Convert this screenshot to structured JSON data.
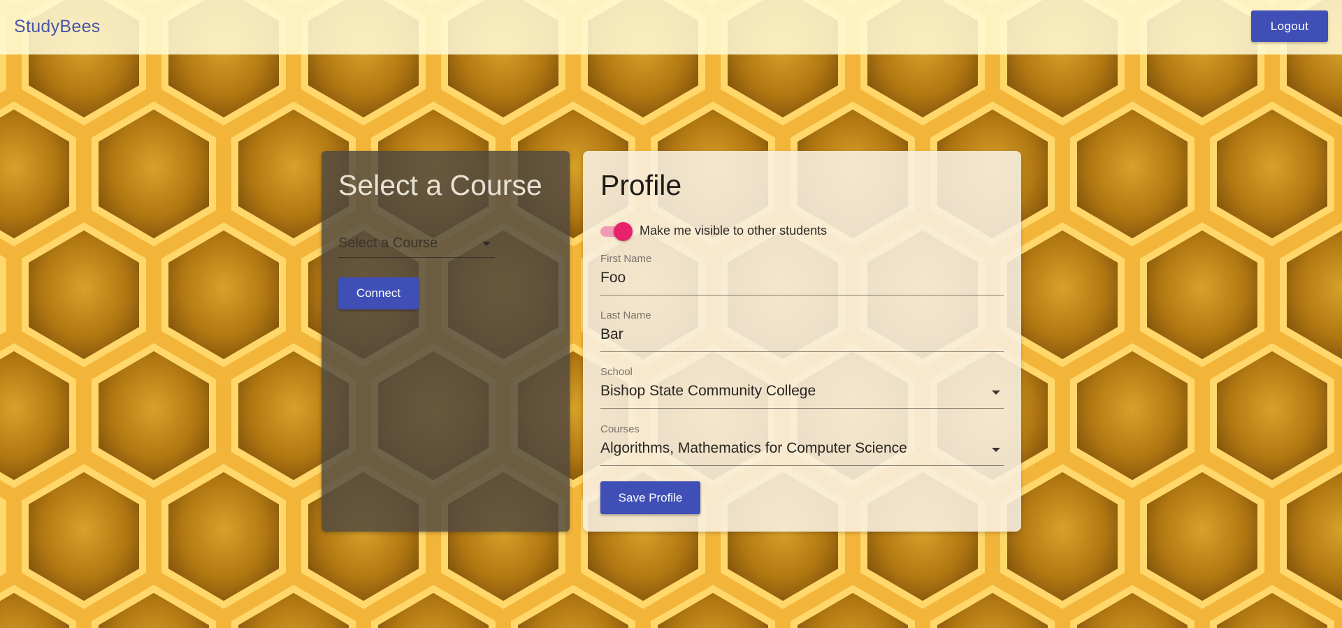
{
  "app": {
    "title": "StudyBees",
    "logout_label": "Logout"
  },
  "course_panel": {
    "title": "Select a Course",
    "select_placeholder": "Select a Course",
    "connect_label": "Connect"
  },
  "profile": {
    "title": "Profile",
    "visibility_toggle": {
      "label": "Make me visible to other students",
      "on": true
    },
    "fields": {
      "first_name": {
        "label": "First Name",
        "value": "Foo"
      },
      "last_name": {
        "label": "Last Name",
        "value": "Bar"
      },
      "school": {
        "label": "School",
        "value": "Bishop State Community College"
      },
      "courses": {
        "label": "Courses",
        "value": "Algorithms, Mathematics for Computer Science"
      }
    },
    "save_label": "Save Profile"
  },
  "colors": {
    "primary": "#3f4fb5",
    "accent": "#e8226a",
    "honey": "#d9a21f"
  }
}
